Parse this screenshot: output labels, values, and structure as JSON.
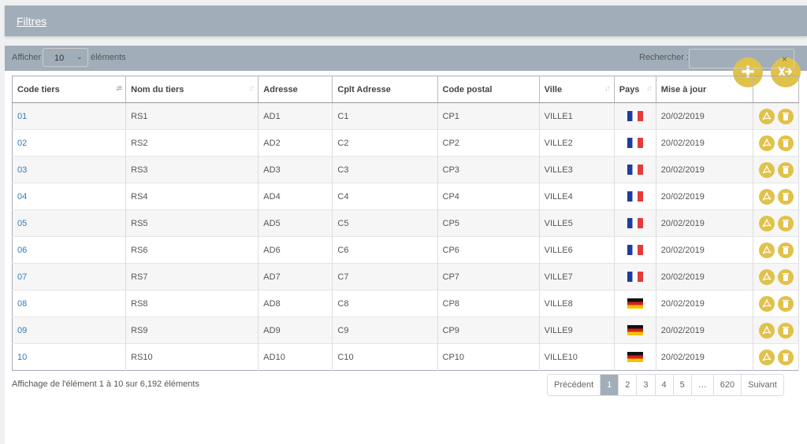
{
  "filters": {
    "label": "Filtres"
  },
  "toolbar": {
    "add_icon": "plus-icon",
    "export_icon": "export-excel-icon"
  },
  "length": {
    "prefix": "Afficher",
    "value": "10",
    "suffix": "éléments"
  },
  "search": {
    "label": "Recherche r:",
    "value": "",
    "clear": "×"
  },
  "columns": [
    "Code tiers",
    "Nom du tiers",
    "Adresse",
    "Cplt Adresse",
    "Code postal",
    "Ville",
    "Pays",
    "Mise à jour",
    ""
  ],
  "rows": [
    {
      "code": "01",
      "name": "RS1",
      "address": "AD1",
      "cplt": "C1",
      "postal": "CP1",
      "city": "VILLE1",
      "country": "FR",
      "updated": "20/02/2019"
    },
    {
      "code": "02",
      "name": "RS2",
      "address": "AD2",
      "cplt": "C2",
      "postal": "CP2",
      "city": "VILLE2",
      "country": "FR",
      "updated": "20/02/2019"
    },
    {
      "code": "03",
      "name": "RS3",
      "address": "AD3",
      "cplt": "C3",
      "postal": "CP3",
      "city": "VILLE3",
      "country": "FR",
      "updated": "20/02/2019"
    },
    {
      "code": "04",
      "name": "RS4",
      "address": "AD4",
      "cplt": "C4",
      "postal": "CP4",
      "city": "VILLE4",
      "country": "FR",
      "updated": "20/02/2019"
    },
    {
      "code": "05",
      "name": "RS5",
      "address": "AD5",
      "cplt": "C5",
      "postal": "CP5",
      "city": "VILLE5",
      "country": "FR",
      "updated": "20/02/2019"
    },
    {
      "code": "06",
      "name": "RS6",
      "address": "AD6",
      "cplt": "C6",
      "postal": "CP6",
      "city": "VILLE6",
      "country": "FR",
      "updated": "20/02/2019"
    },
    {
      "code": "07",
      "name": "RS7",
      "address": "AD7",
      "cplt": "C7",
      "postal": "CP7",
      "city": "VILLE7",
      "country": "FR",
      "updated": "20/02/2019"
    },
    {
      "code": "08",
      "name": "RS8",
      "address": "AD8",
      "cplt": "C8",
      "postal": "CP8",
      "city": "VILLE8",
      "country": "DE",
      "updated": "20/02/2019"
    },
    {
      "code": "09",
      "name": "RS9",
      "address": "AD9",
      "cplt": "C9",
      "postal": "CP9",
      "city": "VILLE9",
      "country": "DE",
      "updated": "20/02/2019"
    },
    {
      "code": "10",
      "name": "RS10",
      "address": "AD10",
      "cplt": "C10",
      "postal": "CP10",
      "city": "VILLE10",
      "country": "DE",
      "updated": "20/02/2019"
    }
  ],
  "row_actions": [
    "pdf-icon",
    "trash-icon"
  ],
  "info": "Affichage de l'élément 1 à 10 sur 6,192 éléments",
  "pagination": {
    "prev": "Précédent",
    "pages": [
      "1",
      "2",
      "3",
      "4",
      "5",
      "…",
      "620"
    ],
    "current": "1",
    "next": "Suivant"
  },
  "colors": {
    "header": "#a1aeb9",
    "accent": "#e0c24a",
    "link": "#337ab7"
  }
}
